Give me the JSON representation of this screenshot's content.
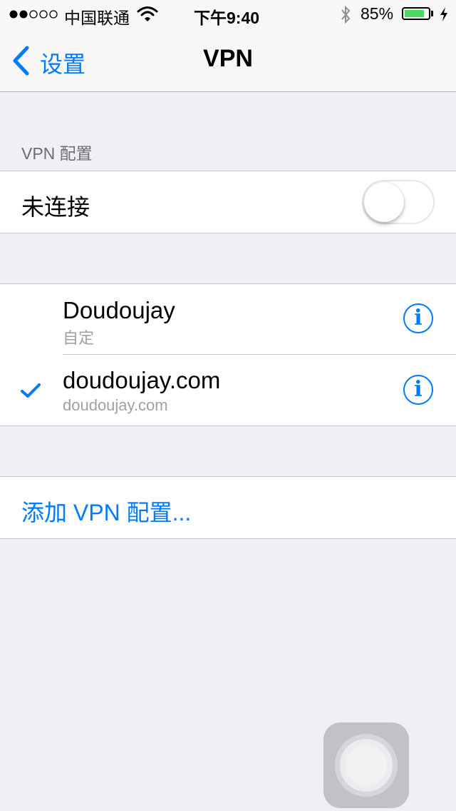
{
  "status_bar": {
    "carrier": "中国联通",
    "time": "下午9:40",
    "battery_percent": "85%",
    "battery_level": 0.85,
    "signal_bars": 2
  },
  "nav": {
    "back_label": "设置",
    "title": "VPN"
  },
  "vpn_section": {
    "header": "VPN 配置",
    "status_label": "未连接",
    "toggle_on": false
  },
  "configs": [
    {
      "name": "Doudoujay",
      "subtitle": "自定",
      "selected": false
    },
    {
      "name": "doudoujay.com",
      "subtitle": "doudoujay.com",
      "selected": true
    }
  ],
  "add_config_label": "添加 VPN 配置...",
  "colors": {
    "accent": "#007aff",
    "background": "#efeff4",
    "battery": "#4cd964"
  },
  "icons": {
    "info": "i"
  }
}
